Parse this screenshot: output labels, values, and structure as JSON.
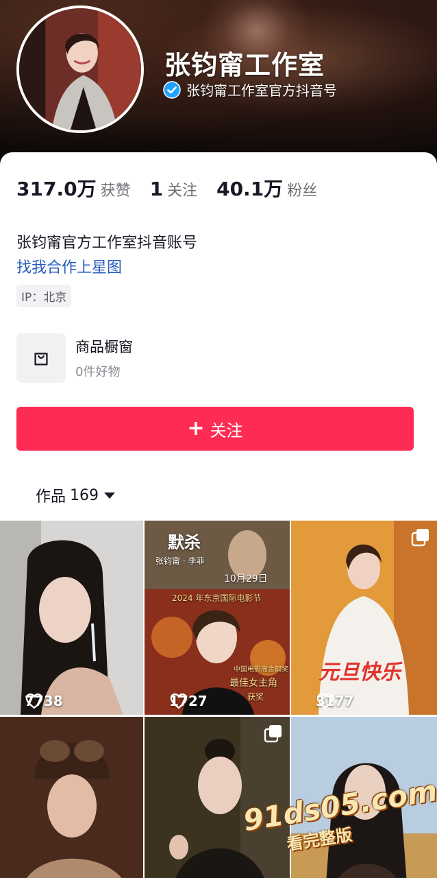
{
  "profile": {
    "name": "张钧甯工作室",
    "verified_text": "张钧甯工作室官方抖音号"
  },
  "stats": [
    {
      "value": "317.0万",
      "label": "获赞"
    },
    {
      "value": "1",
      "label": "关注"
    },
    {
      "value": "40.1万",
      "label": "粉丝"
    }
  ],
  "bio": {
    "line1": "张钧甯官方工作室抖音账号",
    "link": "找我合作上星图",
    "ip": "IP：北京"
  },
  "shop": {
    "title": "商品橱窗",
    "subtitle": "0件好物"
  },
  "follow_button": {
    "plus": "+",
    "label": "关注"
  },
  "works_tab": {
    "label": "作品",
    "count": "169"
  },
  "grid": [
    {
      "likes": "7738",
      "multi": false
    },
    {
      "likes": "1727",
      "multi": false,
      "poster": {
        "title": "默杀",
        "cast": "张钧甯 · 李菲",
        "date": "10月29日",
        "festival": "2024 年东京国际电影节",
        "award_org": "中国电影周金鹤奖",
        "award": "最佳女主角",
        "award_suffix": "获奖"
      }
    },
    {
      "likes": "3177",
      "multi": true,
      "poster": {
        "title": "元旦快乐"
      }
    },
    {
      "multi": false
    },
    {
      "multi": true
    },
    {
      "multi": false
    }
  ],
  "watermark": {
    "site": "91ds05.com",
    "sub": "看完整版"
  },
  "colors": {
    "accent": "#fe2c55",
    "link": "#285dbd",
    "verify": "#20a3ff"
  }
}
